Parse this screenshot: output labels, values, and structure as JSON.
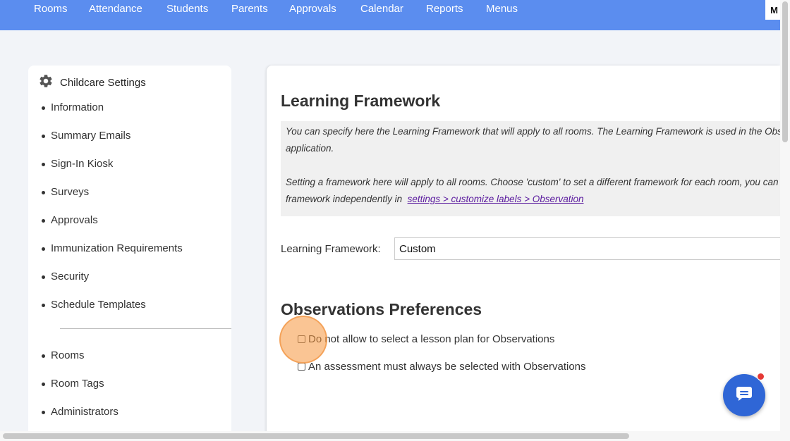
{
  "nav": {
    "items": [
      "Rooms",
      "Attendance",
      "Students",
      "Parents",
      "Approvals",
      "Calendar",
      "Reports",
      "Menus"
    ],
    "avatar_label": "M"
  },
  "sidebar": {
    "title": "Childcare Settings",
    "title_icon": "gear-icon",
    "group1": [
      "Information",
      "Summary Emails",
      "Sign-In Kiosk",
      "Surveys",
      "Approvals",
      "Immunization Requirements",
      "Security",
      "Schedule Templates"
    ],
    "group2": [
      "Rooms",
      "Room Tags",
      "Administrators"
    ]
  },
  "main": {
    "framework_heading": "Learning Framework",
    "info_line1": "You can specify here the Learning Framework that will apply to all rooms. The Learning Framework is used in the Obs",
    "info_line2": "application.",
    "info_line3": "Setting a framework here will apply to all rooms. Choose 'custom' to set a different framework for each room, you can",
    "info_line4_prefix": "framework independently in",
    "info_link": "settings > customize labels > Observation",
    "framework_label": "Learning Framework:",
    "framework_value": "Custom",
    "prefs_heading": "Observations Preferences",
    "pref1_label": "Do not allow to select a lesson plan for Observations",
    "pref2_label": "An assessment must always be selected with Observations"
  },
  "colors": {
    "nav_bg": "#5b8def",
    "chat_btn": "#2f66d6",
    "link": "#5a1a9e",
    "highlight": "#f5963c"
  }
}
